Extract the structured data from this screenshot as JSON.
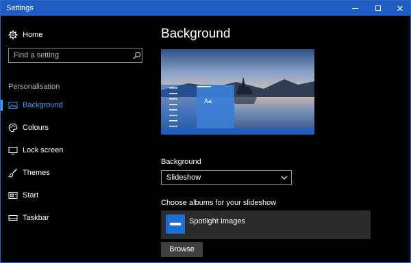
{
  "window": {
    "title": "Settings",
    "accent": "#1e5ec5"
  },
  "sidebar": {
    "home_label": "Home",
    "search_placeholder": "Find a setting",
    "section_label": "Personalisation",
    "items": [
      {
        "label": "Background",
        "icon": "picture-icon",
        "selected": true
      },
      {
        "label": "Colours",
        "icon": "palette-icon",
        "selected": false
      },
      {
        "label": "Lock screen",
        "icon": "monitor-icon",
        "selected": false
      },
      {
        "label": "Themes",
        "icon": "paintbrush-icon",
        "selected": false
      },
      {
        "label": "Start",
        "icon": "grid-icon",
        "selected": false
      },
      {
        "label": "Taskbar",
        "icon": "taskbar-icon",
        "selected": false
      }
    ]
  },
  "main": {
    "title": "Background",
    "preview": {
      "sample_text": "Aa"
    },
    "background_label": "Background",
    "background_value": "Slideshow",
    "albums_label": "Choose albums for your slideshow",
    "album_name": "Spotlight Images",
    "browse_label": "Browse"
  }
}
